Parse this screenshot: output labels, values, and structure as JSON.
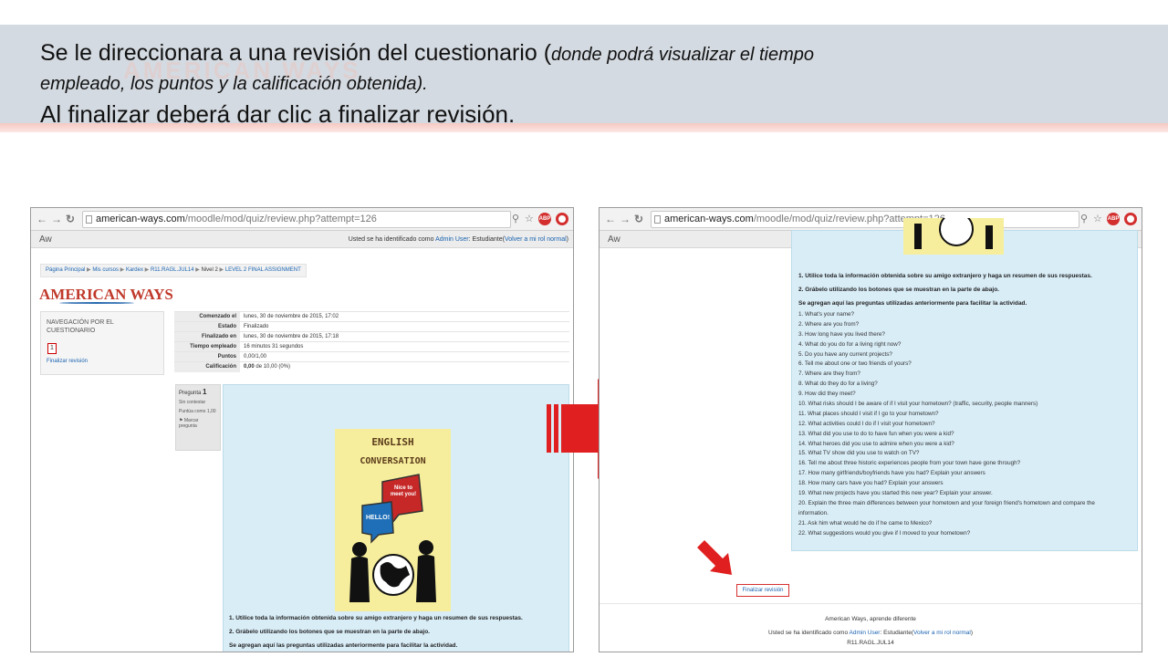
{
  "slide": {
    "watermark": "AMERICAN WAYS",
    "title_line1": "Se le direccionara a una revisión del cuestionario (",
    "title_line1_italic": "donde podrá visualizar el tiempo",
    "title_line2": "empleado, los puntos y la calificación obtenida).",
    "title_line3": "Al finalizar deberá dar clic a finalizar revisión."
  },
  "colors": {
    "band": "#d4dae1",
    "accent_red": "#e02020",
    "link": "#1a63b0",
    "panel_blue": "#d9edf7"
  },
  "browser": {
    "url_host": "american-ways.com",
    "url_path": "/moodle/mod/quiz/review.php?attempt=126",
    "icons": [
      "back-icon",
      "forward-icon",
      "reload-icon",
      "page-icon",
      "zoom-icon",
      "star-icon",
      "adblock-icon",
      "opera-icon"
    ],
    "abp_label": "ABP"
  },
  "moodle": {
    "site_short": "Aw",
    "logged_prefix": "Usted se ha identificado como",
    "user": "Admin User",
    "role_text": ": Estudiante(",
    "role_link": "Volver a mi rol normal",
    "role_close": ")",
    "breadcrumb": [
      "Página Principal",
      "Mis cursos",
      "Kardex",
      "R11.RAGL.JUL14",
      "Nivel 2",
      "LEVEL 2 FINAL ASSIGNMENT"
    ],
    "logo_text": "AMERICAN WAYS",
    "nav_title": "NAVEGACIÓN POR EL CUESTIONARIO",
    "nav_question": "1",
    "finish_review": "Finalizar revisión",
    "summary": [
      {
        "label": "Comenzado el",
        "value": "lunes, 30 de noviembre de 2015, 17:02"
      },
      {
        "label": "Estado",
        "value": "Finalizado"
      },
      {
        "label": "Finalizado en",
        "value": "lunes, 30 de noviembre de 2015, 17:18"
      },
      {
        "label": "Tiempo empleado",
        "value": "16 minutos 31 segundos"
      },
      {
        "label": "Puntos",
        "value": "0,00/1,00"
      },
      {
        "label": "Calificación",
        "value_bold": "0,00",
        "value": " de 10,00 (0%)"
      }
    ],
    "question_info": {
      "pregunta": "Pregunta",
      "number": "1",
      "status": "Sin contestar",
      "score": "Puntúa como 1,00",
      "flag": "Marcar pregunta"
    },
    "poster": {
      "line1": "ENGLISH",
      "line2": "CONVERSATION",
      "bubble1": "Nice to meet you!",
      "bubble2": "HELLO!"
    },
    "instructions": [
      "1. Utilice toda la información obtenida sobre su amigo extranjero y haga un resumen de sus respuestas.",
      "2. Grábelo utilizando los botones que se muestran en la parte de abajo.",
      "Se agregan aquí las preguntas utilizadas anteriormente para facilitar la actividad."
    ],
    "questions": [
      "1.  What's your name?",
      "2.  Where are you from?",
      "3.  How long have you lived there?",
      "4.  What do you do for a living right now?",
      "5.  Do you have any current projects?",
      "6.  Tell me about one or two friends of yours?",
      "7.  Where are they from?",
      "8.  What do they do for a living?",
      "9.  How did they meet?",
      "10. What risks should I be aware of if I visit your hometown? (traffic, security, people manners)",
      "11. What places should I visit if I go to your hometown?",
      "12. What activities could I do if I visit your hometown?",
      "13. What did you use to do to have fun when you were a kid?",
      "14. What heroes did you use to admire when you were a kid?",
      "15. What TV show did you use to watch on TV?",
      "16. Tell me about three historic experiences people from your town have gone through?",
      "17. How many girlfriends/boyfriends have you had? Explain your answers",
      "18. How many cars have you had? Explain your answers",
      "19. What new projects have you started this new year? Explain your answer.",
      "20. Explain the three main differences between your hometown and your foreign friend's hometown and compare the",
      "      information.",
      "21. Ask him what would he do if he came to Mexico?",
      "22. What suggestions would you give if I moved to your hometown?"
    ],
    "footer_tagline": "American Ways, aprende diferente",
    "footer_course": "R11.RAGL.JUL14"
  }
}
